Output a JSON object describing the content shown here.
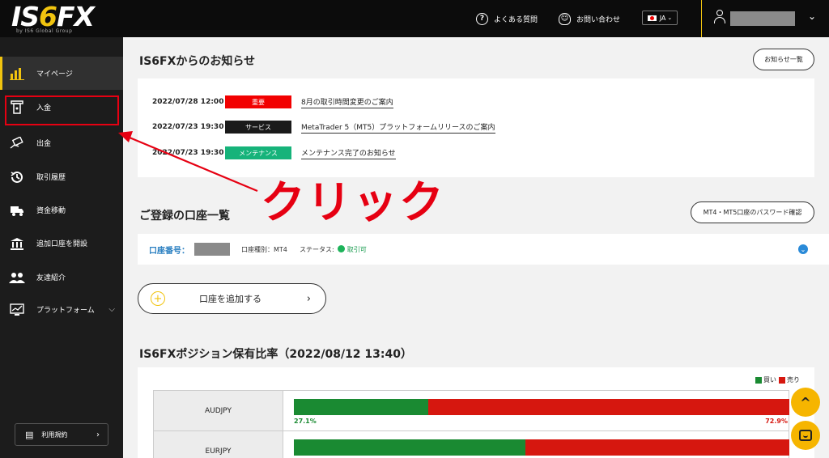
{
  "header": {
    "logo_text_a": "IS",
    "logo_text_b": "6",
    "logo_text_c": "FX",
    "logo_sub": "by IS6 Global Group",
    "faq_label": "よくある質問",
    "contact_label": "お問い合わせ",
    "lang_label": "JA",
    "lang_chevron": "⌄",
    "user_chevron": "⌄"
  },
  "sidebar": {
    "items": [
      {
        "label": "マイページ",
        "icon": "chart-bars-icon"
      },
      {
        "label": "入金",
        "icon": "deposit-atm-icon"
      },
      {
        "label": "出金",
        "icon": "withdraw-hand-icon"
      },
      {
        "label": "取引履歴",
        "icon": "history-clock-icon"
      },
      {
        "label": "資金移動",
        "icon": "transfer-truck-icon"
      },
      {
        "label": "追加口座を開設",
        "icon": "bank-icon"
      },
      {
        "label": "友達紹介",
        "icon": "people-icon"
      },
      {
        "label": "プラットフォーム",
        "icon": "monitor-chart-icon"
      }
    ],
    "terms_label": "利用規約"
  },
  "news": {
    "title": "IS6FXからのお知らせ",
    "list_button": "お知らせ一覧",
    "items": [
      {
        "date": "2022/07/28 12:00",
        "tag": "重要",
        "tag_color": "#f20000",
        "title": "8月の取引時間変更のご案内"
      },
      {
        "date": "2022/07/23 19:30",
        "tag": "サービス",
        "tag_color": "#1a1a1a",
        "title": "MetaTrader 5（MT5）プラットフォームリリースのご案内"
      },
      {
        "date": "2022/07/23 19:30",
        "tag": "メンテナンス",
        "tag_color": "#16b37a",
        "title": "メンテナンス完了のお知らせ"
      }
    ]
  },
  "annotation": "クリック",
  "accounts": {
    "title": "ご登録の口座一覧",
    "password_button": "MT4・MT5口座のパスワード確認",
    "account_label": "口座番号：",
    "account_type": "口座種別：MT4",
    "status_label": "ステータス:",
    "status_value": "取引可",
    "add_button": "口座を追加する"
  },
  "positions": {
    "title": "IS6FXポジション保有比率（2022/08/12 13:40）",
    "legend_buy": "買い",
    "legend_sell": "売り",
    "buy_color": "#1a8a32",
    "sell_color": "#d6170f",
    "rows": [
      {
        "pair": "AUDJPY",
        "buy": 27.1,
        "sell": 72.9,
        "buy_label": "27.1%",
        "sell_label": "72.9%"
      },
      {
        "pair": "EURJPY",
        "buy": 46.7,
        "sell": 53.3,
        "buy_label": "46.7%",
        "sell_label": "53.3%"
      }
    ]
  },
  "fab": {
    "up_icon": "chevron-up-icon",
    "chat_icon": "chat-icon"
  }
}
